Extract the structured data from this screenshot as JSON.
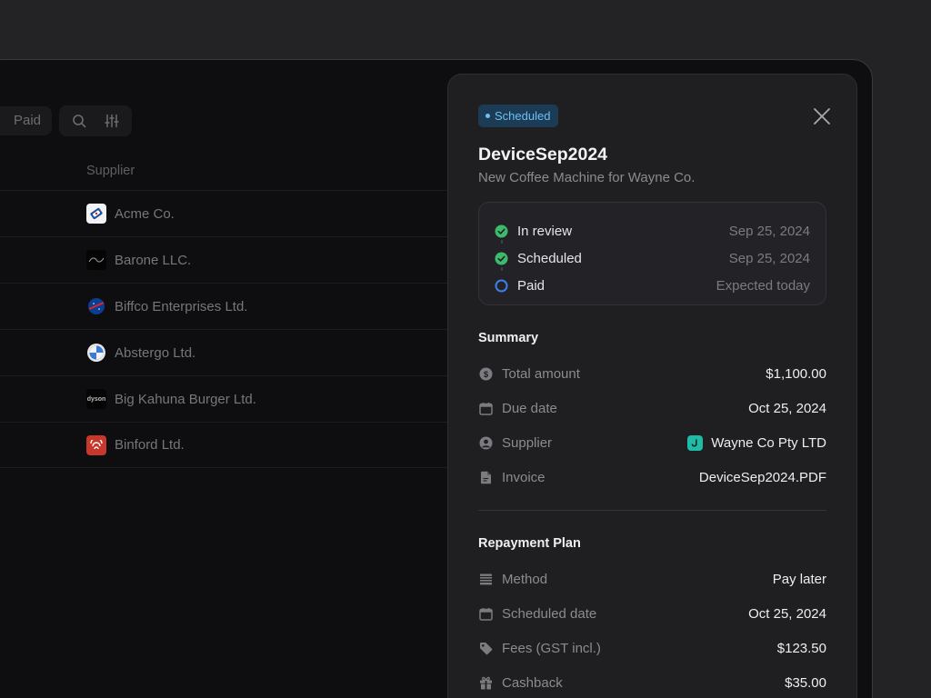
{
  "background_app": {
    "filters": [
      {
        "label": "Paid"
      }
    ],
    "table": {
      "column_header": "Supplier",
      "rows": [
        {
          "name": "Acme Co.",
          "logo_icon": "acme-logo-icon",
          "logo_color": "#ffffff"
        },
        {
          "name": "Barone LLC.",
          "logo_icon": "barone-logo-icon",
          "logo_color": "#000000"
        },
        {
          "name": "Biffco Enterprises Ltd.",
          "logo_icon": "biffco-logo-icon",
          "logo_color": "#0b3d91"
        },
        {
          "name": "Abstergo Ltd.",
          "logo_icon": "abstergo-logo-icon",
          "logo_color": "#ffffff"
        },
        {
          "name": "Big Kahuna Burger Ltd.",
          "logo_icon": "dyson",
          "logo_color": "#000000"
        },
        {
          "name": "Binford Ltd.",
          "logo_icon": "binford-logo-icon",
          "logo_color": "#c8372c"
        }
      ]
    }
  },
  "panel": {
    "status_badge": "Scheduled",
    "title": "DeviceSep2024",
    "subtitle": "New Coffee Machine for Wayne Co.",
    "timeline": [
      {
        "label": "In review",
        "date": "Sep 25, 2024",
        "state": "done"
      },
      {
        "label": "Scheduled",
        "date": "Sep 25, 2024",
        "state": "done"
      },
      {
        "label": "Paid",
        "date": "Expected today",
        "state": "pending"
      }
    ],
    "summary": {
      "heading": "Summary",
      "items": [
        {
          "icon": "dollar-coin-icon",
          "label": "Total amount",
          "value": "$1,100.00"
        },
        {
          "icon": "calendar-icon",
          "label": "Due date",
          "value": "Oct 25, 2024"
        },
        {
          "icon": "user-circle-icon",
          "label": "Supplier",
          "value": "Wayne Co Pty LTD"
        },
        {
          "icon": "document-icon",
          "label": "Invoice",
          "value": "DeviceSep2024.PDF"
        }
      ]
    },
    "repayment": {
      "heading": "Repayment Plan",
      "items": [
        {
          "icon": "list-icon",
          "label": "Method",
          "value": "Pay later"
        },
        {
          "icon": "calendar-icon",
          "label": "Scheduled date",
          "value": "Oct 25, 2024"
        },
        {
          "icon": "tag-icon",
          "label": "Fees (GST incl.)",
          "value": "$123.50"
        },
        {
          "icon": "gift-icon",
          "label": "Cashback",
          "value": "$35.00"
        }
      ]
    },
    "colors": {
      "accent_done": "#3dbb6c",
      "accent_pending": "#3f7ee8",
      "badge_bg": "#1c3b55",
      "badge_text": "#6cc0f3",
      "supplier_logo": "#1fbba6"
    }
  }
}
